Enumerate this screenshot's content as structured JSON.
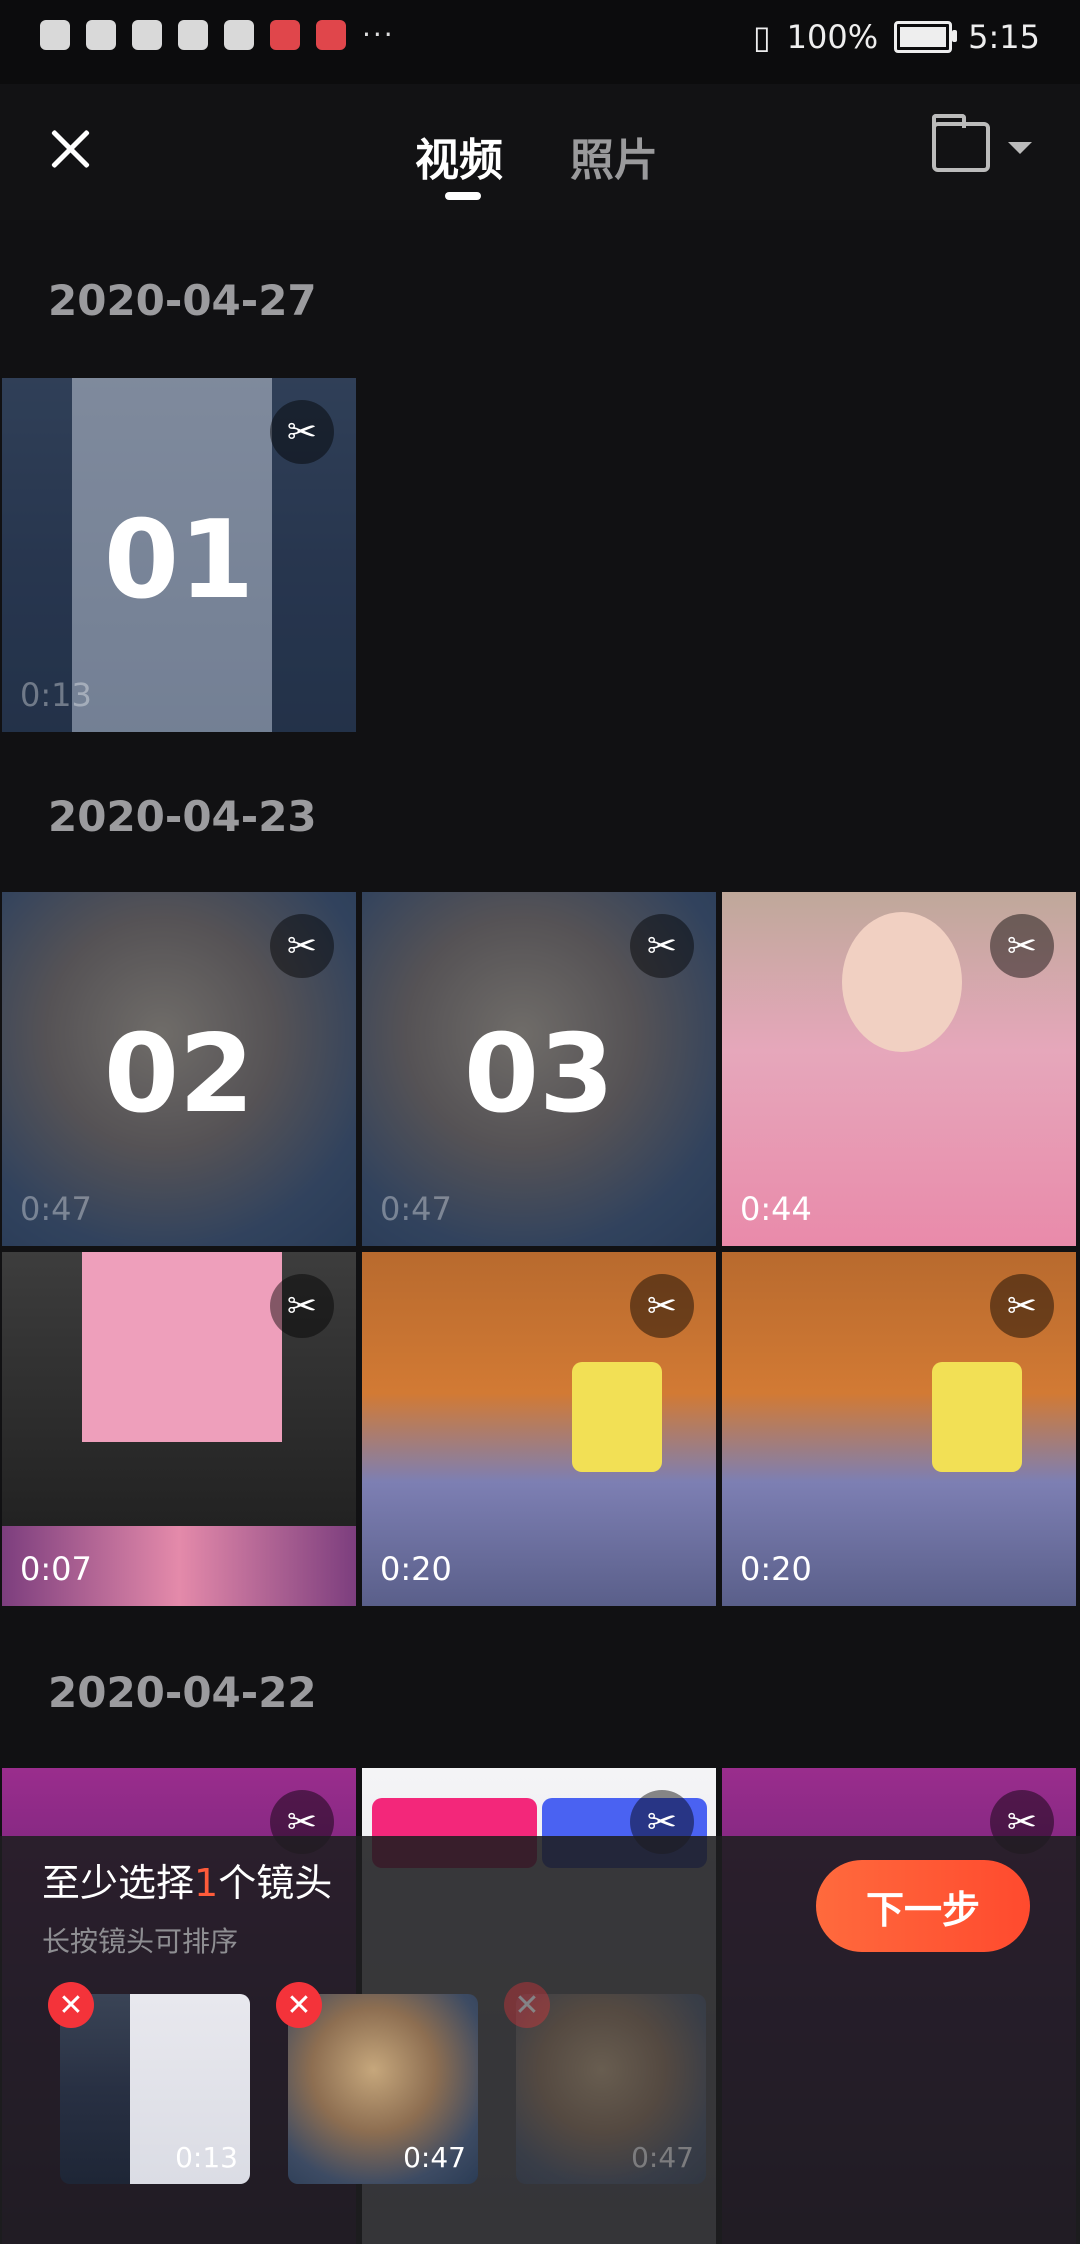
{
  "status_bar": {
    "battery": "100%",
    "time": "5:15",
    "more": "···"
  },
  "header": {
    "tabs": [
      "视频",
      "照片"
    ],
    "active_tab": "视频"
  },
  "sections": [
    {
      "date": "2020-04-27",
      "items": [
        {
          "index": "01",
          "duration": "0:13",
          "selected": true
        }
      ]
    },
    {
      "date": "2020-04-23",
      "items": [
        {
          "index": "02",
          "duration": "0:47",
          "selected": true
        },
        {
          "index": "03",
          "duration": "0:47",
          "selected": true
        },
        {
          "index": "",
          "duration": "0:44",
          "selected": false
        },
        {
          "index": "",
          "duration": "0:07",
          "selected": false
        },
        {
          "index": "",
          "duration": "0:20",
          "selected": false
        },
        {
          "index": "",
          "duration": "0:20",
          "selected": false
        }
      ]
    },
    {
      "date": "2020-04-22",
      "items": []
    }
  ],
  "selection_panel": {
    "hint_prefix": "至少选择",
    "hint_count": "1",
    "hint_suffix": "个镜头",
    "subhint": "长按镜头可排序",
    "next_label": "下一步",
    "selected": [
      {
        "duration": "0:13"
      },
      {
        "duration": "0:47"
      },
      {
        "duration": "0:47"
      }
    ]
  },
  "icons": {
    "close": "close-icon",
    "folder": "folder-icon",
    "cut": "scissors-icon",
    "remove": "remove-icon"
  },
  "colors": {
    "accent": "#ff5b3a",
    "remove": "#f4333a",
    "background": "#111113"
  }
}
